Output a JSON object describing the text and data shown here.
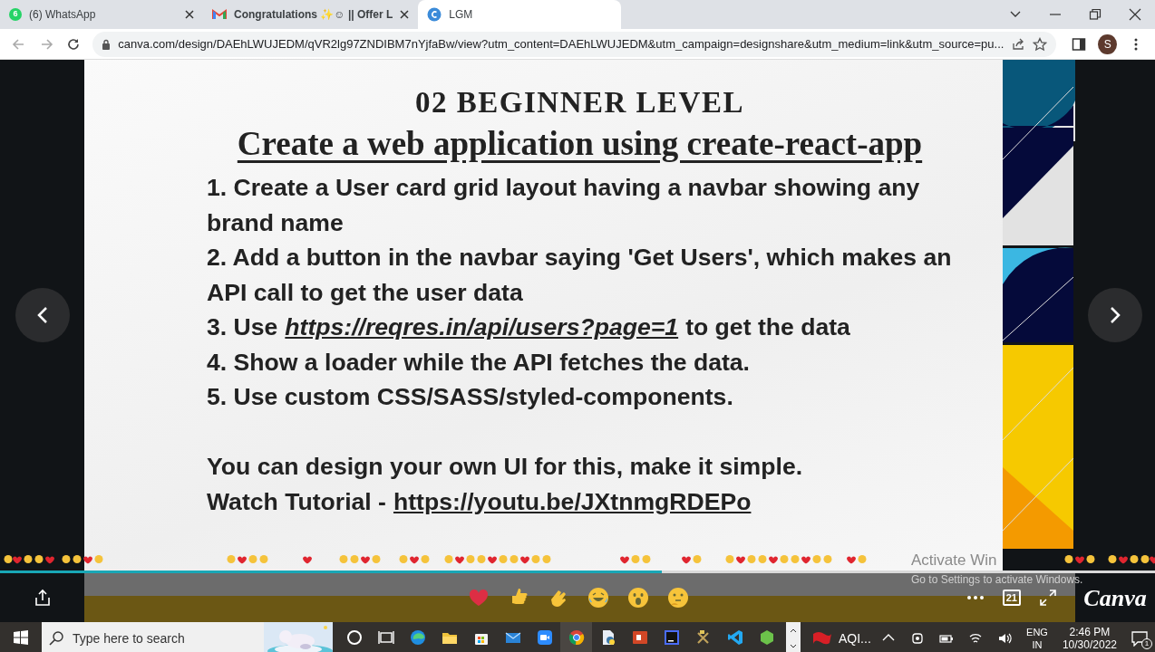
{
  "browser": {
    "tabs": [
      {
        "title": "(6) WhatsApp",
        "kind": "chat",
        "badge": "6",
        "selected": false
      },
      {
        "title": "Congratulations ✨☺ || Offer L",
        "kind": "mail",
        "selected": false
      },
      {
        "title": "LGM",
        "kind": "design",
        "selected": true
      }
    ],
    "url": "canva.com/design/DAEhLWUJEDM/qVR2lg97ZNDIBM7nYjfaBw/view?utm_content=DAEhLWUJEDM&utm_campaign=designshare&utm_medium=link&utm_source=pu...",
    "profile": "S"
  },
  "slide": {
    "heading": "02 BEGINNER LEVEL",
    "title": "Create a web application using create-react-app",
    "items": [
      {
        "text": "1. Create a User card grid layout having a navbar showing any brand name"
      },
      {
        "text": "2. Add a button in the navbar saying 'Get Users', which makes an API call to get the user data"
      },
      {
        "text": "3. Use",
        "link": "https://reqres.in/api/users?page=1",
        "after": "to get the data"
      },
      {
        "text": "4. Show a loader while the API fetches the data."
      },
      {
        "text": "5. Use custom CSS/SASS/styled-components."
      }
    ],
    "note": "You can design your own UI for this, make it simple.",
    "tutorial": {
      "text": "Watch Tutorial -",
      "link": "https://youtu.be/JXtnmgRDEPo"
    }
  },
  "player": {
    "progress": {
      "level": 0.573
    },
    "reactions": [
      {
        "kind": "heart"
      },
      {
        "kind": "thumb"
      },
      {
        "kind": "clap"
      },
      {
        "kind": "laugh"
      },
      {
        "kind": "wow"
      },
      {
        "kind": "think"
      }
    ],
    "page_count": "21",
    "logo": "Canva"
  },
  "activation": {
    "title": "Activate Win",
    "subtitle": "Go to Settings to activate Windows."
  },
  "taskbar": {
    "search_placeholder": "Type here to search",
    "apps": [
      {
        "kind": "cortana",
        "selected": false
      },
      {
        "kind": "taskview",
        "selected": false
      },
      {
        "kind": "edge",
        "selected": false
      },
      {
        "kind": "explorer",
        "selected": false
      },
      {
        "kind": "store",
        "selected": false
      },
      {
        "kind": "mail",
        "selected": false
      },
      {
        "kind": "zoom",
        "selected": false
      },
      {
        "kind": "chrome",
        "selected": true
      },
      {
        "kind": "python",
        "selected": false
      },
      {
        "kind": "ppt",
        "selected": false
      },
      {
        "kind": "intellij",
        "selected": false
      },
      {
        "kind": "tools",
        "selected": false
      },
      {
        "kind": "vscode",
        "selected": false
      },
      {
        "kind": "node",
        "selected": false
      }
    ],
    "weather": "AQI...",
    "language": "ENG",
    "region": "IN",
    "time": "2:46 PM",
    "date": "10/30/2022",
    "notifications": "1"
  }
}
